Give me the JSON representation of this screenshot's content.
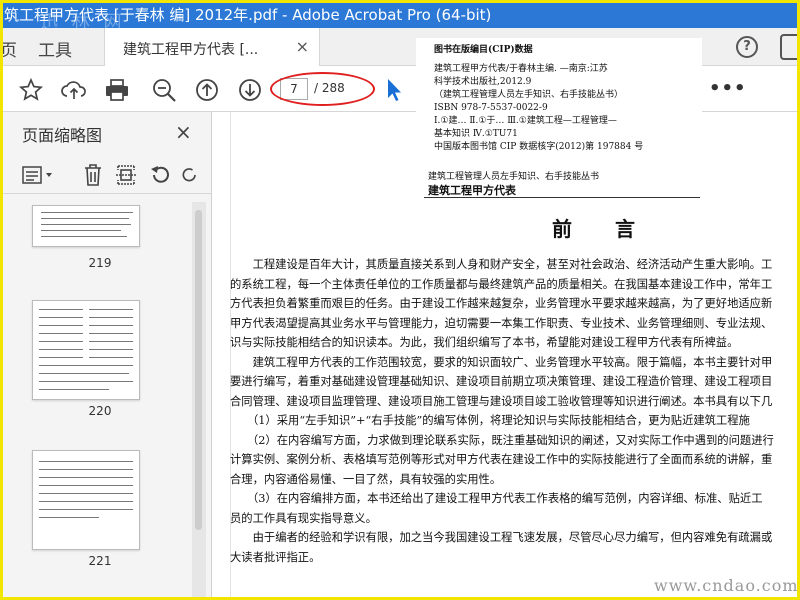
{
  "window": {
    "title": "筑工程甲方代表 [于春林 编] 2012年.pdf - Adobe Acrobat Pro (64-bit)",
    "watermark": "迅 林 网"
  },
  "tabs": {
    "home": "页",
    "tools": "工具",
    "document": "建筑工程甲方代表 [...",
    "close": "×",
    "help": "?"
  },
  "toolbar": {
    "icons": [
      "star-icon",
      "upload-icon",
      "print-icon",
      "zoom-out-icon",
      "page-up-icon",
      "page-down-icon",
      "select-cursor-icon",
      "more-icon"
    ],
    "page_current": "7",
    "page_total": "/ 288",
    "more": "•••"
  },
  "sidebar": {
    "title": "页面缩略图",
    "close": "×",
    "tool_icons": [
      "thumbnail-options-icon",
      "delete-icon",
      "extract-icon",
      "undo-icon",
      "redo-icon"
    ],
    "thumbnails": [
      {
        "label": "219"
      },
      {
        "label": "220"
      },
      {
        "label": "221"
      }
    ]
  },
  "document": {
    "cip_title": "图书在版编目(CIP)数据",
    "cip_lines": [
      "建筑工程甲方代表/于春林主编. —南京:江苏",
      "科学技术出版社,2012.9",
      "（建筑工程管理人员左手知识、右手技能丛书）",
      "ISBN 978-7-5537-0022-9",
      "Ⅰ.①建…  Ⅱ.①于…   Ⅲ.①建筑工程—工程管理—",
      "基本知识  Ⅳ.①TU71",
      "中国版本图书馆 CIP 数据核字(2012)第 197884 号"
    ],
    "series_note": "建筑工程管理人员左手知识、右手技能丛书",
    "book_title": "建筑工程甲方代表",
    "preface_heading": "前 言",
    "paragraphs": [
      "　　工程建设是百年大计，其质量直接关系到人身和财产安全，甚至对社会政治、经济活动产生重大影响。工",
      "的系统工程，每一个主体责任单位的工作质量都与最终建筑产品的质量相关。在我国基本建设工作中，常年工",
      "方代表担负着繁重而艰巨的任务。由于建设工作越来越复杂，业务管理水平要求越来越高，为了更好地适应新",
      "甲方代表渴望提高其业务水平与管理能力，迫切需要一本集工作职责、专业技术、业务管理细则、专业法规、",
      "识与实际技能相结合的知识读本。为此，我们组织编写了本书，希望能对建设工程甲方代表有所裨益。",
      "　　建筑工程甲方代表的工作范围较宽，要求的知识面较广、业务管理水平较高。限于篇幅，本书主要针对甲",
      "要进行编写，着重对基础建设管理基础知识、建设项目前期立项决策管理、建设工程造价管理、建设工程项目",
      "合同管理、建设项目监理管理、建设项目施工管理与建设项目竣工验收管理等知识进行阐述。本书具有以下几",
      "　　（1）采用“左手知识”+“右手技能”的编写体例，将理论知识与实际技能相结合，更为贴近建筑工程施",
      "　　（2）在内容编写方面，力求做到理论联系实际，既注重基础知识的阐述，又对实际工作中遇到的问题进行",
      "计算实例、案例分析、表格填写范例等形式对甲方代表在建设工作中的实际技能进行了全面而系统的讲解，重",
      "合理，内容通俗易懂、一目了然，具有较强的实用性。",
      "　　（3）在内容编排方面，本书还给出了建设工程甲方代表工作表格的编写范例，内容详细、标准、贴近工",
      "员的工作具有现实指导意义。",
      "　　由于编者的经验和学识有限，加之当今我国建设工程飞速发展，尽管尽心尽力编写，但内容难免有疏漏或",
      "大读者批评指正。"
    ]
  },
  "bottom_watermark": "www.cndao.com",
  "colors": {
    "titlebar": "#2b78d6",
    "highlight_oval": "#e02020",
    "frame": "#f2e600",
    "cursor_blue": "#1a6fd6"
  }
}
